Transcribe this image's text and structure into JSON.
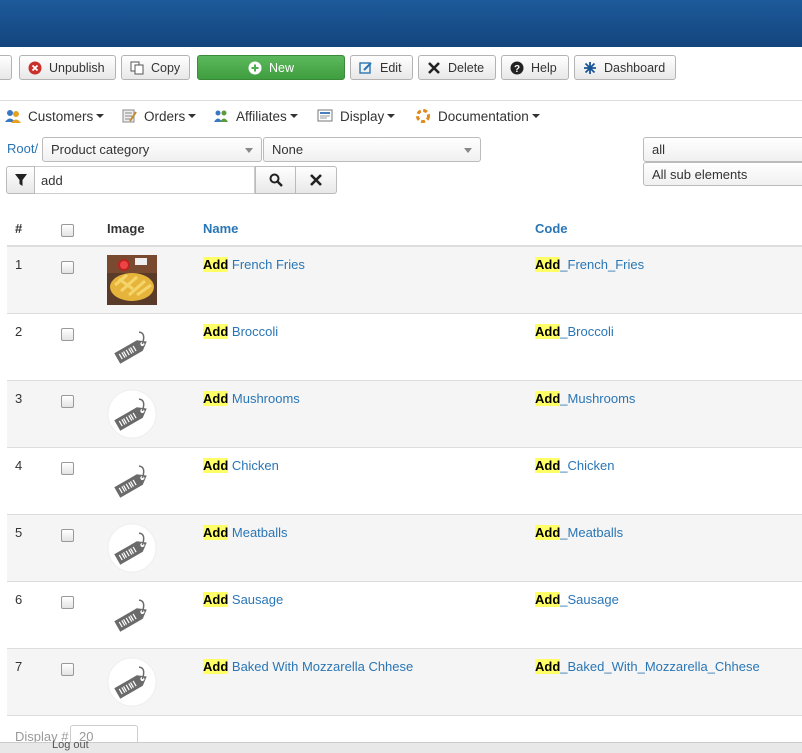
{
  "toolbar": {
    "unpublish": "Unpublish",
    "copy": "Copy",
    "new": "New",
    "edit": "Edit",
    "delete": "Delete",
    "help": "Help",
    "dashboard": "Dashboard"
  },
  "menu": {
    "customers": "Customers",
    "orders": "Orders",
    "affiliates": "Affiliates",
    "display": "Display",
    "documentation": "Documentation"
  },
  "filters": {
    "root": "Root/",
    "category_select": "Product category",
    "none_select": "None",
    "search_value": "add",
    "scope_select": "all",
    "sub_select": "All sub elements"
  },
  "table": {
    "headers": {
      "num": "#",
      "image": "Image",
      "name": "Name",
      "code": "Code"
    },
    "highlight": "Add",
    "rows": [
      {
        "num": "1",
        "name_rest": " French Fries",
        "code_rest": "_French_Fries",
        "image": "photo"
      },
      {
        "num": "2",
        "name_rest": " Broccoli",
        "code_rest": "_Broccoli",
        "image": "tag"
      },
      {
        "num": "3",
        "name_rest": " Mushrooms",
        "code_rest": "_Mushrooms",
        "image": "tag-circle"
      },
      {
        "num": "4",
        "name_rest": " Chicken",
        "code_rest": "_Chicken",
        "image": "tag"
      },
      {
        "num": "5",
        "name_rest": " Meatballs",
        "code_rest": "_Meatballs",
        "image": "tag-circle"
      },
      {
        "num": "6",
        "name_rest": " Sausage",
        "code_rest": "_Sausage",
        "image": "tag"
      },
      {
        "num": "7",
        "name_rest": " Baked With Mozzarella Chhese",
        "code_rest": "_Baked_With_Mozzarella_Chhese",
        "image": "tag-circle"
      }
    ]
  },
  "footer": {
    "display_label": "Display #",
    "display_value": "20",
    "status_text": "Log out"
  },
  "colors": {
    "topbar": "#1a5595",
    "link": "#2a76b5",
    "new_button": "#4cae4c",
    "highlight": "#ffff66"
  }
}
